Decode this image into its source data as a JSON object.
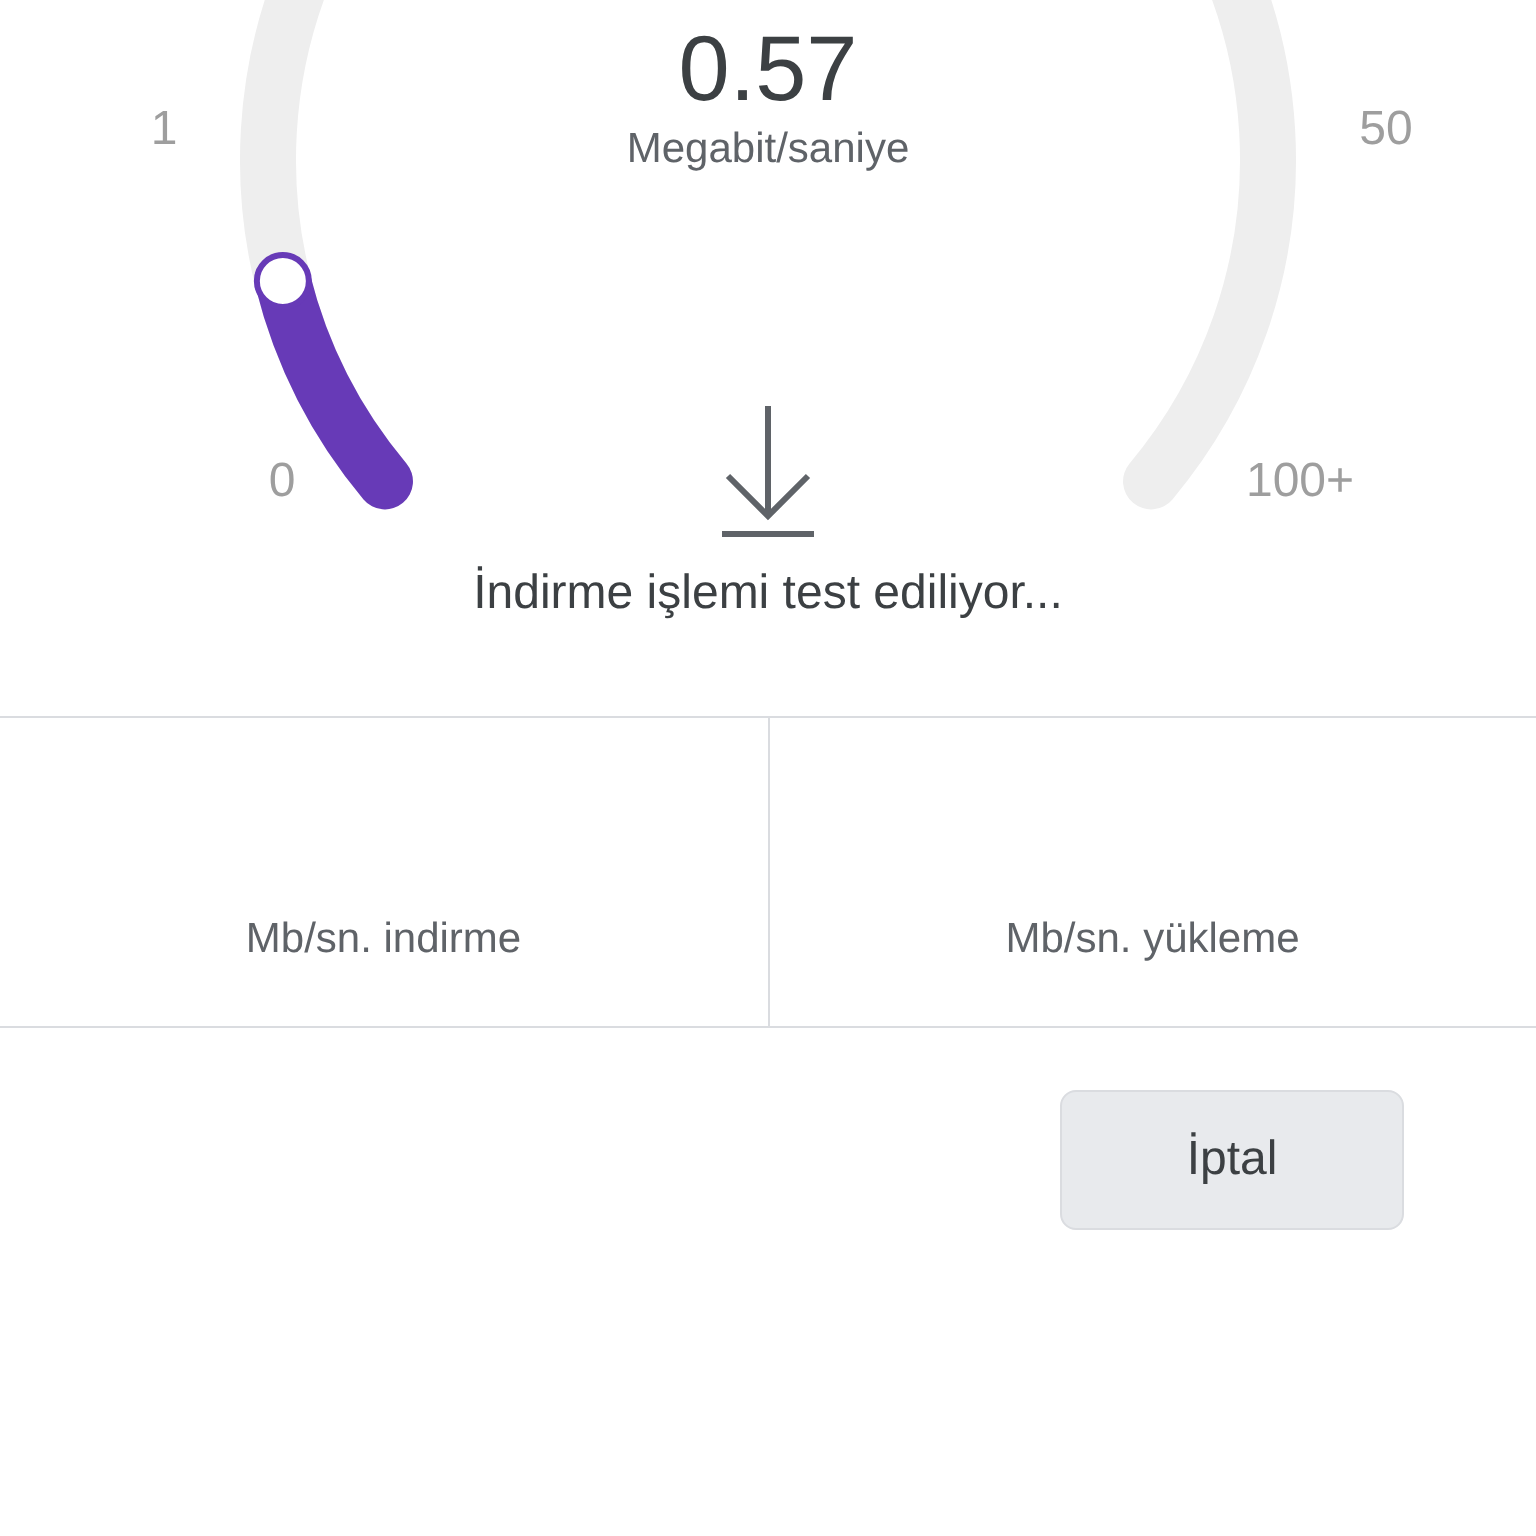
{
  "gauge": {
    "value": "0.57",
    "unit": "Megabit/saniye",
    "level": 0.1,
    "scale_labels": [
      "0",
      "1",
      "50",
      "100+"
    ]
  },
  "status": "İndirme işlemi test ediliyor...",
  "results": [
    {
      "label": "Mb/sn. indirme"
    },
    {
      "label": "Mb/sn. yükleme"
    }
  ],
  "cancel_button": "İptal"
}
